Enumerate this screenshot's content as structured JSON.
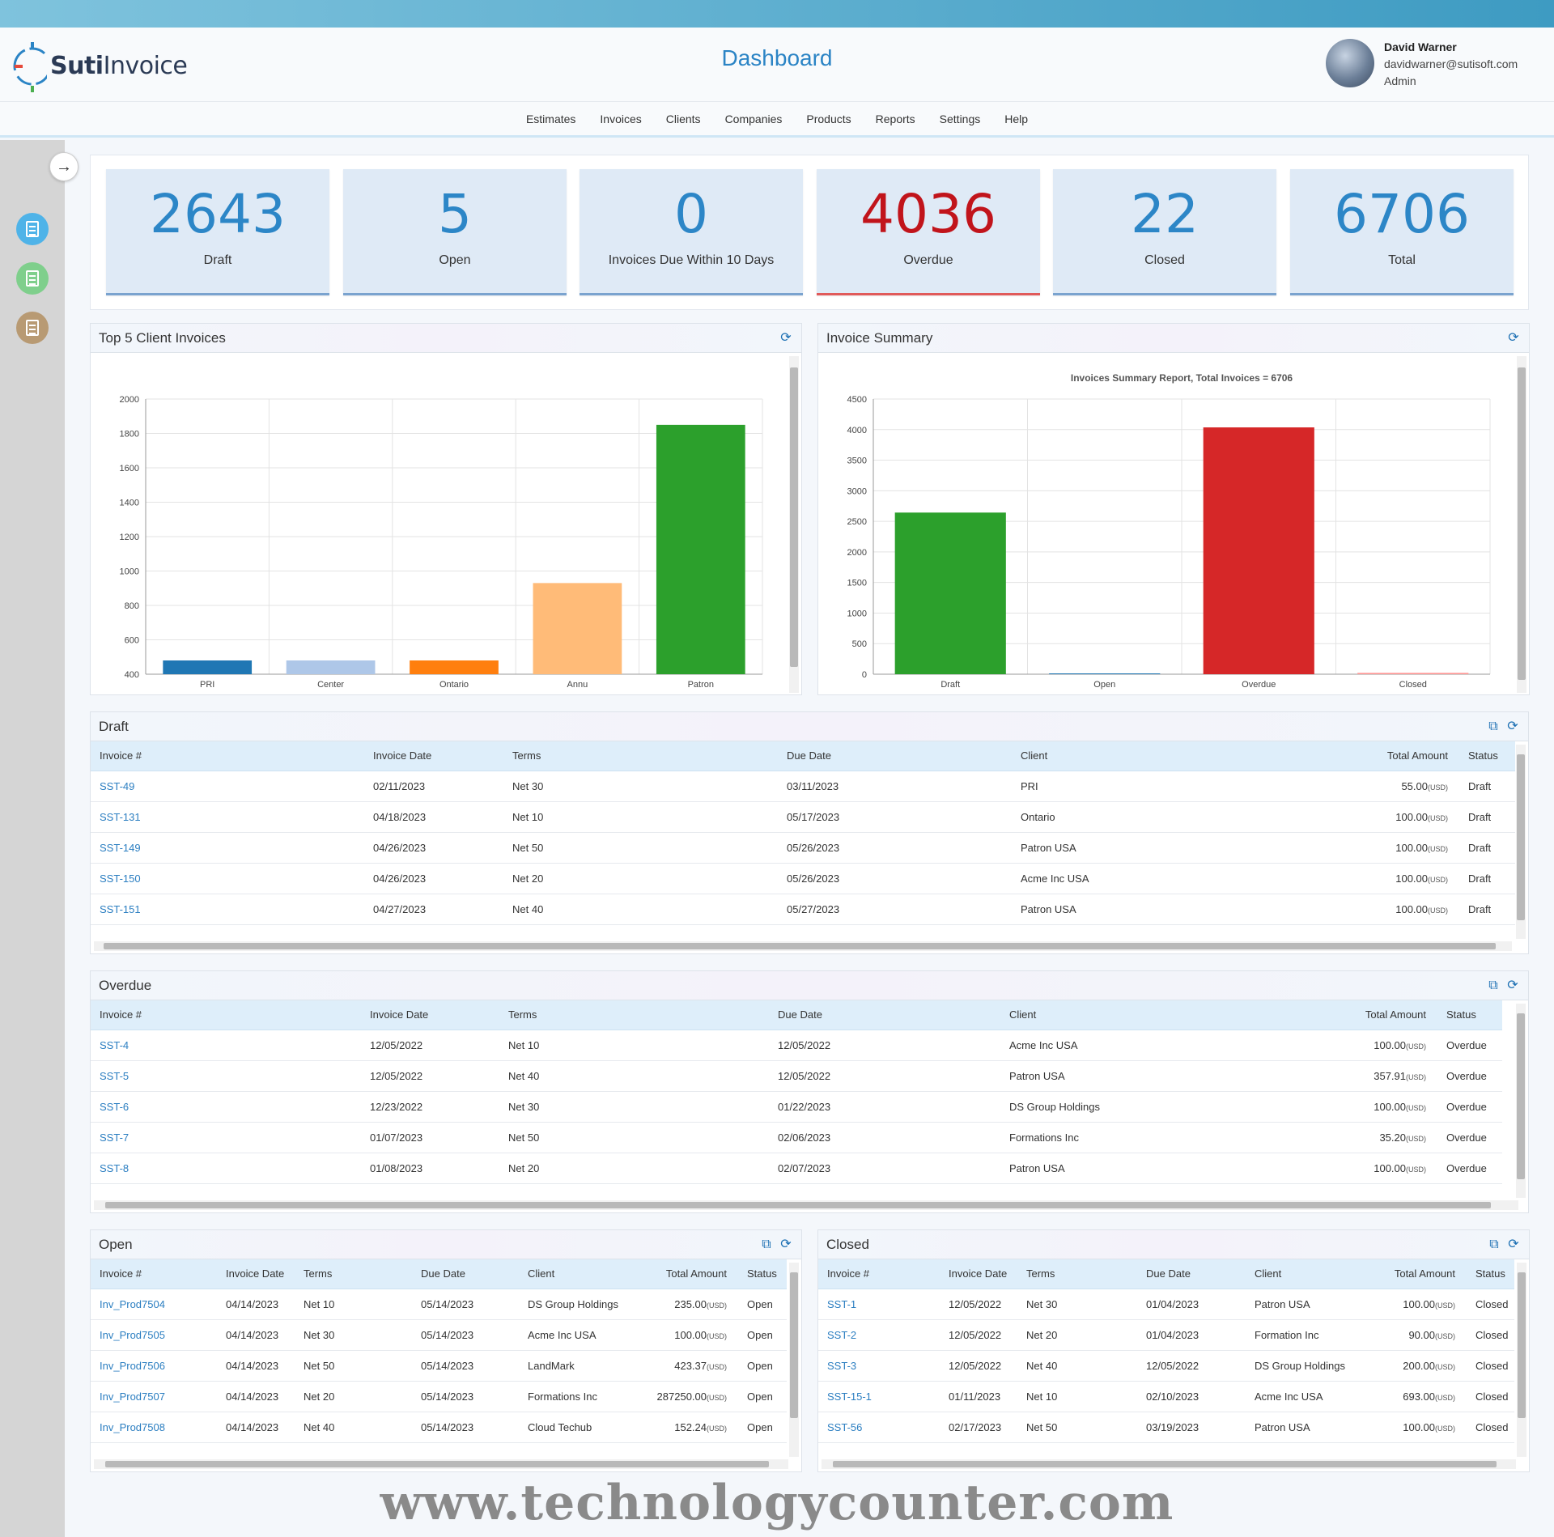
{
  "app": {
    "logo_text_bold": "Suti",
    "logo_text": "Invoice",
    "page_title": "Dashboard"
  },
  "user": {
    "name": "David Warner",
    "email": "davidwarner@sutisoft.com",
    "role": "Admin"
  },
  "nav": [
    "Estimates",
    "Invoices",
    "Clients",
    "Companies",
    "Products",
    "Reports",
    "Settings",
    "Help"
  ],
  "sidebar": {
    "toggle_icon": "arrow-right-icon",
    "icons": [
      {
        "name": "estimates-icon",
        "color": "#4fb3e8"
      },
      {
        "name": "invoices-icon",
        "color": "#7fcf8c"
      },
      {
        "name": "reports-icon",
        "color": "#b89a73"
      }
    ]
  },
  "stats": [
    {
      "value": "2643",
      "label": "Draft"
    },
    {
      "value": "5",
      "label": "Open"
    },
    {
      "value": "0",
      "label": "Invoices Due Within 10 Days"
    },
    {
      "value": "4036",
      "label": "Overdue"
    },
    {
      "value": "22",
      "label": "Closed"
    },
    {
      "value": "6706",
      "label": "Total"
    }
  ],
  "colors": {
    "accent": "#2c86c7",
    "overdue": "#c1141b",
    "link": "#2b7ec1"
  },
  "panels": {
    "top5": {
      "title": "Top 5 Client Invoices"
    },
    "summary": {
      "title": "Invoice Summary"
    },
    "draft": {
      "title": "Draft"
    },
    "overdue": {
      "title": "Overdue"
    },
    "open": {
      "title": "Open"
    },
    "closed": {
      "title": "Closed"
    }
  },
  "chart_data": [
    {
      "type": "bar",
      "title": "",
      "categories": [
        "PRI",
        "Center",
        "Ontario",
        "Annu",
        "Patron"
      ],
      "values": [
        480,
        480,
        480,
        930,
        1850
      ],
      "colors": [
        "#1f77b4",
        "#aec7e8",
        "#ff7f0e",
        "#ffbb78",
        "#2ca02c"
      ],
      "ylim": [
        400,
        2000
      ],
      "yticks": [
        400,
        600,
        800,
        1000,
        1200,
        1400,
        1600,
        1800,
        2000
      ],
      "xlabel": "",
      "ylabel": "",
      "grid": true
    },
    {
      "type": "bar",
      "title": "Invoices Summary Report, Total Invoices = 6706",
      "categories": [
        "Draft",
        "Open",
        "Overdue",
        "Closed"
      ],
      "values": [
        2643,
        5,
        4036,
        22
      ],
      "colors": [
        "#2ca02c",
        "#1f77b4",
        "#d62728",
        "#ff9896"
      ],
      "ylim": [
        0,
        4500
      ],
      "yticks": [
        0,
        500,
        1000,
        1500,
        2000,
        2500,
        3000,
        3500,
        4000,
        4500
      ],
      "xlabel": "",
      "ylabel": "",
      "grid": true
    }
  ],
  "tables": {
    "headers": [
      "Invoice #",
      "Invoice Date",
      "Terms",
      "Due Date",
      "Client",
      "Total Amount",
      "Status"
    ],
    "currency": "(USD)",
    "draft": [
      [
        "SST-49",
        "02/11/2023",
        "Net 30",
        "03/11/2023",
        "PRI",
        "55.00",
        "Draft"
      ],
      [
        "SST-131",
        "04/18/2023",
        "Net 10",
        "05/17/2023",
        "Ontario",
        "100.00",
        "Draft"
      ],
      [
        "SST-149",
        "04/26/2023",
        "Net 50",
        "05/26/2023",
        "Patron USA",
        "100.00",
        "Draft"
      ],
      [
        "SST-150",
        "04/26/2023",
        "Net 20",
        "05/26/2023",
        "Acme Inc USA",
        "100.00",
        "Draft"
      ],
      [
        "SST-151",
        "04/27/2023",
        "Net 40",
        "05/27/2023",
        "Patron USA",
        "100.00",
        "Draft"
      ]
    ],
    "overdue": [
      [
        "SST-4",
        "12/05/2022",
        "Net 10",
        "12/05/2022",
        "Acme Inc USA",
        "100.00",
        "Overdue"
      ],
      [
        "SST-5",
        "12/05/2022",
        "Net 40",
        "12/05/2022",
        "Patron USA",
        "357.91",
        "Overdue"
      ],
      [
        "SST-6",
        "12/23/2022",
        "Net 30",
        "01/22/2023",
        "DS Group Holdings",
        "100.00",
        "Overdue"
      ],
      [
        "SST-7",
        "01/07/2023",
        "Net 50",
        "02/06/2023",
        "Formations Inc",
        "35.20",
        "Overdue"
      ],
      [
        "SST-8",
        "01/08/2023",
        "Net 20",
        "02/07/2023",
        "Patron USA",
        "100.00",
        "Overdue"
      ]
    ],
    "open": [
      [
        "Inv_Prod7504",
        "04/14/2023",
        "Net 10",
        "05/14/2023",
        "DS Group Holdings",
        "235.00",
        "Open"
      ],
      [
        "Inv_Prod7505",
        "04/14/2023",
        "Net 30",
        "05/14/2023",
        "Acme Inc USA",
        "100.00",
        "Open"
      ],
      [
        "Inv_Prod7506",
        "04/14/2023",
        "Net 50",
        "05/14/2023",
        "LandMark",
        "423.37",
        "Open"
      ],
      [
        "Inv_Prod7507",
        "04/14/2023",
        "Net 20",
        "05/14/2023",
        "Formations Inc",
        "287250.00",
        "Open"
      ],
      [
        "Inv_Prod7508",
        "04/14/2023",
        "Net 40",
        "05/14/2023",
        "Cloud Techub",
        "152.24",
        "Open"
      ]
    ],
    "closed": [
      [
        "SST-1",
        "12/05/2022",
        "Net 30",
        "01/04/2023",
        "Patron USA",
        "100.00",
        "Closed"
      ],
      [
        "SST-2",
        "12/05/2022",
        "Net 20",
        "01/04/2023",
        "Formation Inc",
        "90.00",
        "Closed"
      ],
      [
        "SST-3",
        "12/05/2022",
        "Net 40",
        "12/05/2022",
        "DS Group Holdings",
        "200.00",
        "Closed"
      ],
      [
        "SST-15-1",
        "01/11/2023",
        "Net 10",
        "02/10/2023",
        "Acme Inc USA",
        "693.00",
        "Closed"
      ],
      [
        "SST-56",
        "02/17/2023",
        "Net 50",
        "03/19/2023",
        "Patron USA",
        "100.00",
        "Closed"
      ]
    ]
  },
  "watermark": "www.technologycounter.com"
}
